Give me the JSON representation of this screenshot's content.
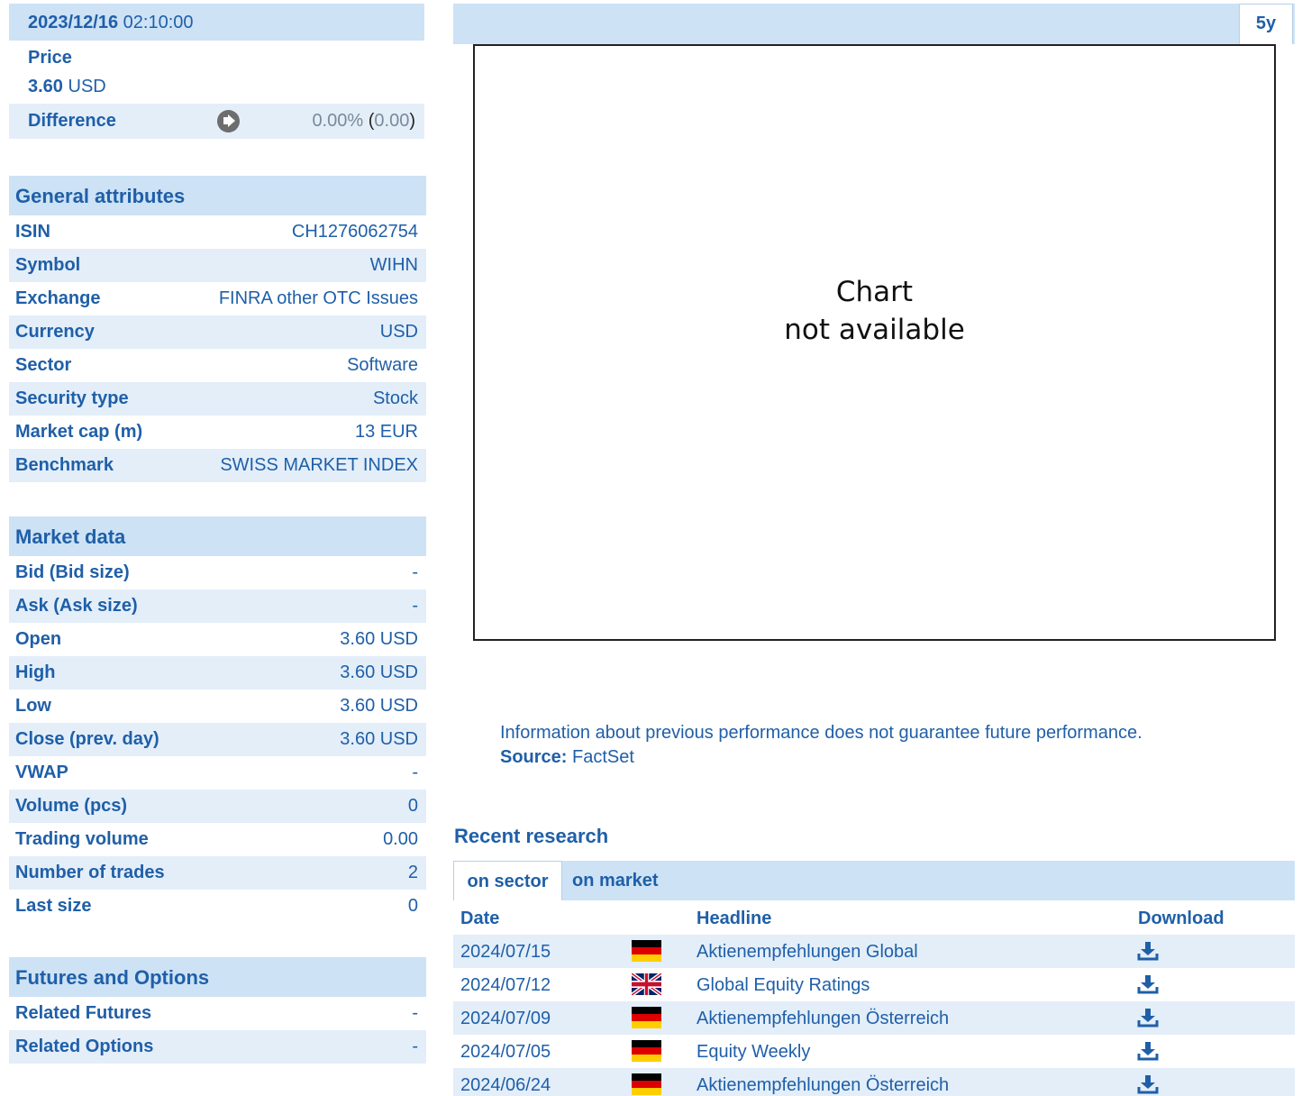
{
  "quote": {
    "date": "2023/12/16",
    "time": "02:10:00",
    "price_label": "Price",
    "price_value": "3.60",
    "price_currency": "USD",
    "difference_label": "Difference",
    "difference_pct": "0.00%",
    "difference_abs": "0.00",
    "difference_icon": "arrow-right-icon"
  },
  "general": {
    "title": "General attributes",
    "rows": [
      {
        "k": "ISIN",
        "v": "CH1276062754"
      },
      {
        "k": "Symbol",
        "v": "WIHN"
      },
      {
        "k": "Exchange",
        "v": "FINRA other OTC Issues"
      },
      {
        "k": "Currency",
        "v": "USD"
      },
      {
        "k": "Sector",
        "v": "Software"
      },
      {
        "k": "Security type",
        "v": "Stock"
      },
      {
        "k": "Market cap (m)",
        "v": "13 EUR"
      },
      {
        "k": "Benchmark",
        "v": "SWISS MARKET INDEX"
      }
    ]
  },
  "market": {
    "title": "Market data",
    "rows": [
      {
        "k": "Bid (Bid size)",
        "v": "-"
      },
      {
        "k": "Ask (Ask size)",
        "v": "-"
      },
      {
        "k": "Open",
        "v": "3.60 USD"
      },
      {
        "k": "High",
        "v": "3.60 USD"
      },
      {
        "k": "Low",
        "v": "3.60 USD"
      },
      {
        "k": "Close (prev. day)",
        "v": "3.60 USD"
      },
      {
        "k": "VWAP",
        "v": "-"
      },
      {
        "k": "Volume (pcs)",
        "v": "0"
      },
      {
        "k": "Trading volume",
        "v": "0.00"
      },
      {
        "k": "Number of trades",
        "v": "2"
      },
      {
        "k": "Last size",
        "v": "0"
      }
    ]
  },
  "futures": {
    "title": "Futures and Options",
    "rows": [
      {
        "k": "Related Futures",
        "v": "-"
      },
      {
        "k": "Related Options",
        "v": "-"
      }
    ]
  },
  "chart": {
    "tab_label": "5y",
    "message_line1": "Chart",
    "message_line2": "not available"
  },
  "disclaimer": {
    "text": "Information about previous performance does not guarantee future performance.",
    "source_label": "Source:",
    "source_value": "FactSet"
  },
  "research": {
    "title": "Recent research",
    "tabs": [
      "on sector",
      "on market"
    ],
    "columns": {
      "date": "Date",
      "headline": "Headline",
      "download": "Download"
    },
    "rows": [
      {
        "date": "2024/07/15",
        "flag": "de",
        "headline": "Aktienempfehlungen Global"
      },
      {
        "date": "2024/07/12",
        "flag": "gb",
        "headline": "Global Equity Ratings"
      },
      {
        "date": "2024/07/09",
        "flag": "de",
        "headline": "Aktienempfehlungen Österreich"
      },
      {
        "date": "2024/07/05",
        "flag": "de",
        "headline": "Equity Weekly"
      },
      {
        "date": "2024/06/24",
        "flag": "de",
        "headline": "Aktienempfehlungen Österreich"
      }
    ]
  },
  "colors": {
    "text_blue": "#1f5fa8",
    "header_bg": "#cde2f5",
    "row_alt_bg": "#e3eef9"
  }
}
